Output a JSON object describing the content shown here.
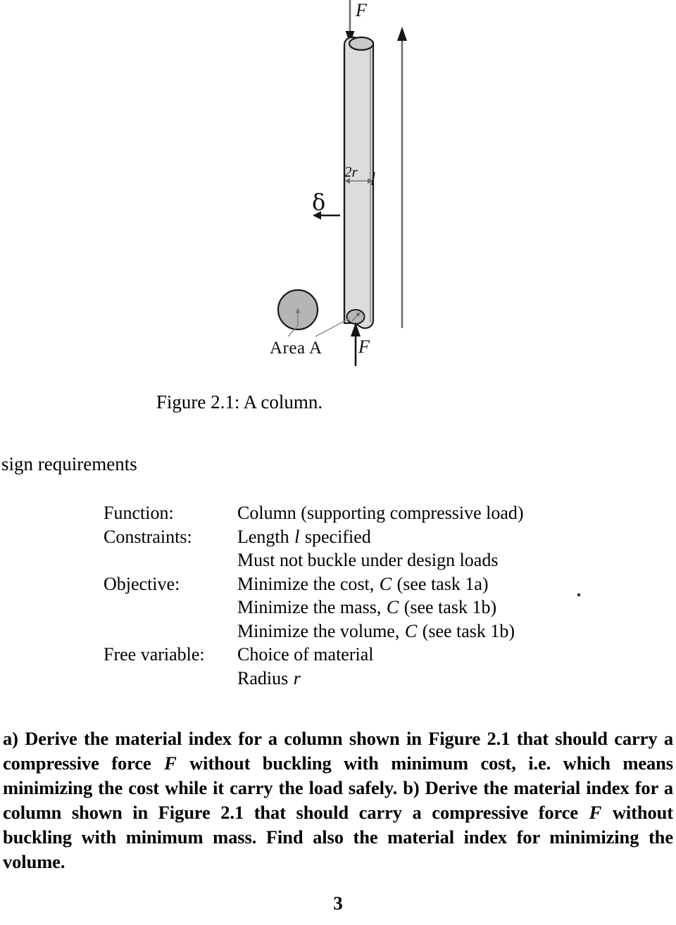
{
  "document": {
    "page_number": "3"
  },
  "figure": {
    "caption": "Figure 2.1: A column.",
    "labels": {
      "force_top": "F",
      "force_bottom": "F",
      "diameter": "2r",
      "length": "l",
      "deflection": "δ",
      "area": "Area A"
    },
    "colors": {
      "column_fill": "#dcdcdc",
      "column_outline": "#1a1a1a",
      "circle_fill": "#b5b5b5",
      "arrow": "#6e6e6e",
      "leader_line": "#8a8a8a"
    }
  },
  "section": {
    "heading": "sign requirements"
  },
  "requirements": {
    "rows": [
      {
        "label": "Function:",
        "value_pre": "Column (supporting compressive load)",
        "value_var": "",
        "value_post": ""
      },
      {
        "label": "Constraints:",
        "value_pre": "Length ",
        "value_var": "l",
        "value_post": " specified"
      },
      {
        "label": "",
        "value_pre": "Must not buckle under design loads",
        "value_var": "",
        "value_post": ""
      },
      {
        "label": "Objective:",
        "value_pre": "Minimize the cost, ",
        "value_var": "C",
        "value_post": " (see task 1a)"
      },
      {
        "label": "",
        "value_pre": "Minimize the mass, ",
        "value_var": "C",
        "value_post": " (see task 1b)"
      },
      {
        "label": "",
        "value_pre": "Minimize the volume, ",
        "value_var": "C",
        "value_post": " (see task 1b)"
      },
      {
        "label": "Free variable:",
        "value_pre": "Choice of material",
        "value_var": "",
        "value_post": ""
      },
      {
        "label": "",
        "value_pre": "Radius ",
        "value_var": "r",
        "value_post": ""
      }
    ]
  },
  "body": {
    "part_a_lead": "a) Derive the material index for a column shown in Figure 2.1 that should carry a compressive force ",
    "var_force_1": "F",
    "part_a_tail": " without buckling with minimum cost, i.e. which means minimizing the cost while it carry the load safely. ",
    "part_b_lead": "b) Derive the material index for a column shown in Figure 2.1 that should carry a compressive force ",
    "var_force_2": "F",
    "part_b_tail": " without buckling with minimum mass. Find also the material index for minimizing the volume."
  }
}
